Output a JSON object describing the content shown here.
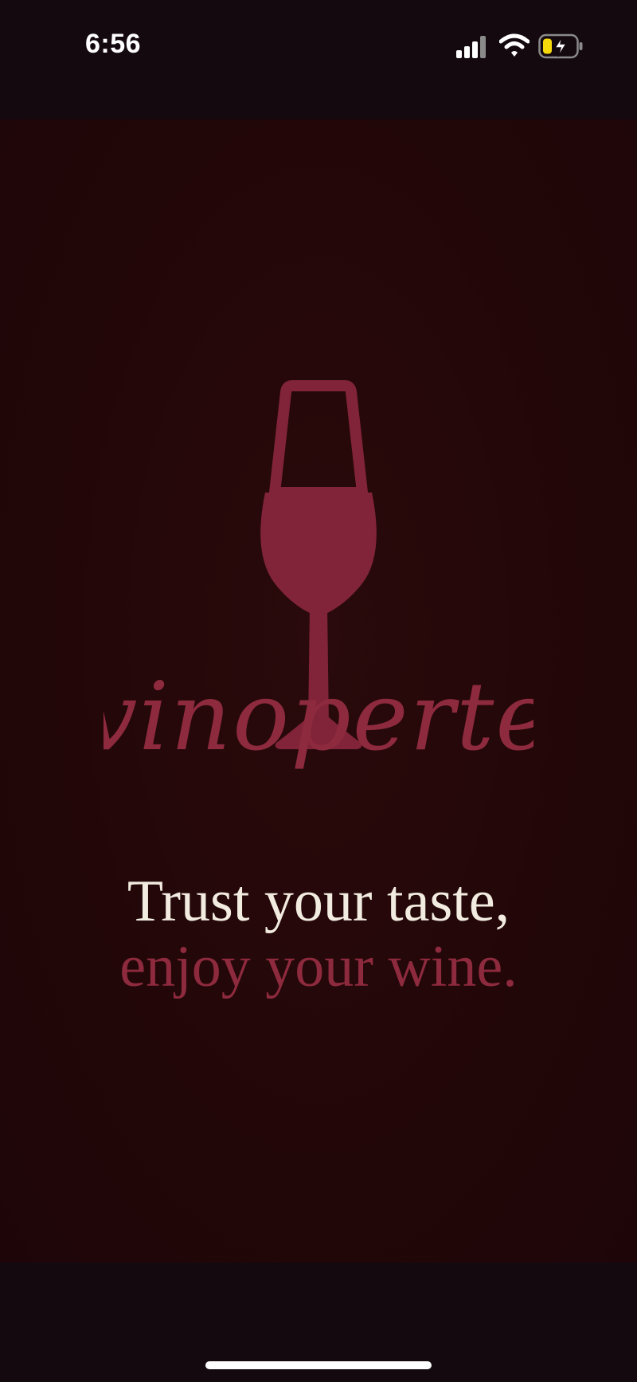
{
  "status_bar": {
    "time": "6:56",
    "signal_icon": "cellular-signal-icon",
    "wifi_icon": "wifi-icon",
    "battery_icon": "battery-charging-icon",
    "battery_accent": "#f5d90a"
  },
  "splash": {
    "logo_icon": "wine-glass-icon",
    "brand_name": "vinoperte",
    "tagline_line1": "Trust your taste,",
    "tagline_line2": "enjoy your wine."
  },
  "colors": {
    "background": "#220708",
    "brand": "#8e2a3e",
    "tagline_light": "#f2ebe0"
  }
}
